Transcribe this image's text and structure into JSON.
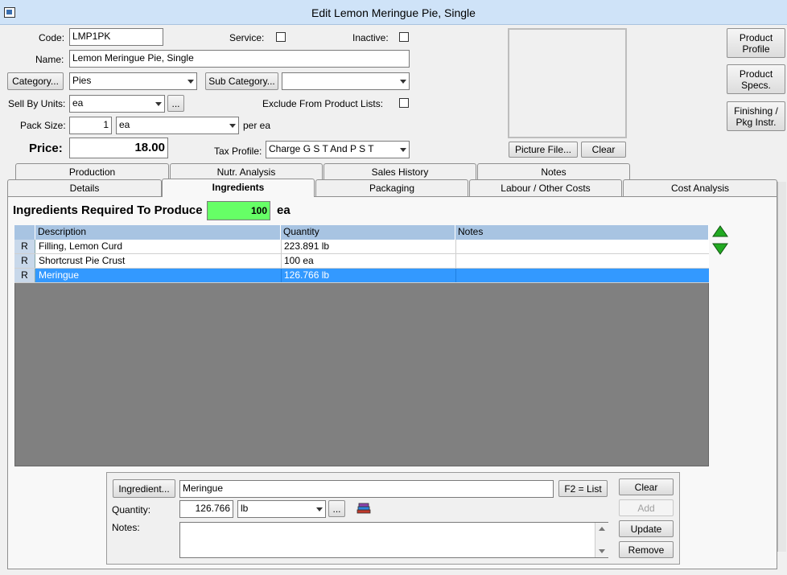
{
  "window": {
    "title": "Edit Lemon Meringue Pie, Single"
  },
  "form": {
    "code_label": "Code:",
    "code_value": "LMP1PK",
    "service_label": "Service:",
    "inactive_label": "Inactive:",
    "name_label": "Name:",
    "name_value": "Lemon Meringue Pie, Single",
    "category_button": "Category...",
    "category_value": "Pies",
    "subcategory_button": "Sub Category...",
    "subcategory_value": "",
    "sell_by_label": "Sell By Units:",
    "sell_by_value": "ea",
    "ellipsis": "...",
    "exclude_label": "Exclude From Product Lists:",
    "pack_size_label": "Pack Size:",
    "pack_size_value": "1",
    "pack_unit_value": "ea",
    "per_label": "per ea",
    "price_label": "Price:",
    "price_value": "18.00",
    "tax_label": "Tax Profile:",
    "tax_value": "Charge G S T And P S T",
    "picture_button": "Picture File...",
    "picture_clear": "Clear"
  },
  "side_buttons": {
    "profile_l1": "Product",
    "profile_l2": "Profile",
    "specs_l1": "Product",
    "specs_l2": "Specs.",
    "finish_l1": "Finishing /",
    "finish_l2": "Pkg Instr."
  },
  "tabs": {
    "row1": [
      "Production",
      "Nutr. Analysis",
      "Sales History",
      "Notes"
    ],
    "row2": [
      "Details",
      "Ingredients",
      "Packaging",
      "Labour / Other Costs",
      "Cost Analysis"
    ],
    "active": "Ingredients"
  },
  "ingredients": {
    "heading": "Ingredients Required To Produce",
    "qty": "100",
    "unit": "ea",
    "columns": [
      "Description",
      "Quantity",
      "Notes"
    ],
    "rows": [
      {
        "flag": "R",
        "description": "Filling, Lemon Curd",
        "quantity": "223.891 lb",
        "notes": ""
      },
      {
        "flag": "R",
        "description": "Shortcrust Pie Crust",
        "quantity": "100 ea",
        "notes": ""
      },
      {
        "flag": "R",
        "description": "Meringue",
        "quantity": "126.766 lb",
        "notes": ""
      }
    ],
    "selected_row": 2
  },
  "editor": {
    "ingredient_button": "Ingredient...",
    "ingredient_value": "Meringue",
    "f2_button": "F2 = List",
    "quantity_label": "Quantity:",
    "quantity_value": "126.766",
    "unit_value": "lb",
    "ellipsis": "...",
    "notes_label": "Notes:",
    "notes_value": "",
    "clear_button": "Clear",
    "add_button": "Add",
    "update_button": "Update",
    "remove_button": "Remove"
  }
}
